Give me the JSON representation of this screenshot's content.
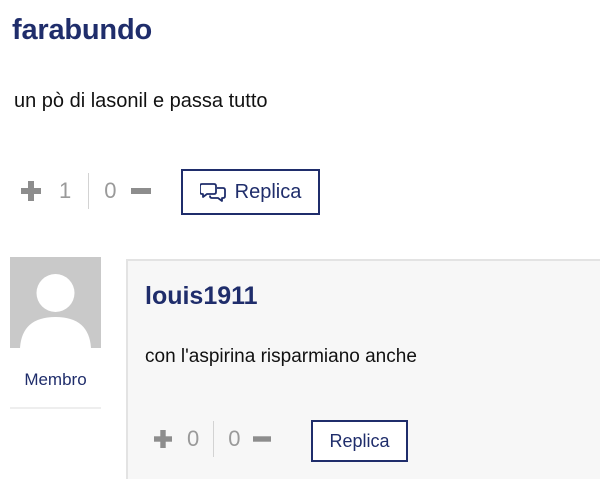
{
  "comment": {
    "author": "farabundo",
    "text": "un pò di lasonil e passa tutto",
    "upvotes": "1",
    "downvotes": "0",
    "reply_label": "Replica"
  },
  "reply": {
    "author": "louis1911",
    "role": "Membro",
    "text": "con l'aspirina risparmiano anche",
    "upvotes": "0",
    "downvotes": "0",
    "reply_label": "Replica"
  },
  "colors": {
    "brand": "#1f2d6b",
    "muted": "#8d8d8d",
    "panel": "#f7f7f7"
  },
  "icons": {
    "upvote": "plus-icon",
    "downvote": "minus-icon",
    "reply": "chat-bubbles-icon",
    "avatar": "default-avatar-icon"
  }
}
